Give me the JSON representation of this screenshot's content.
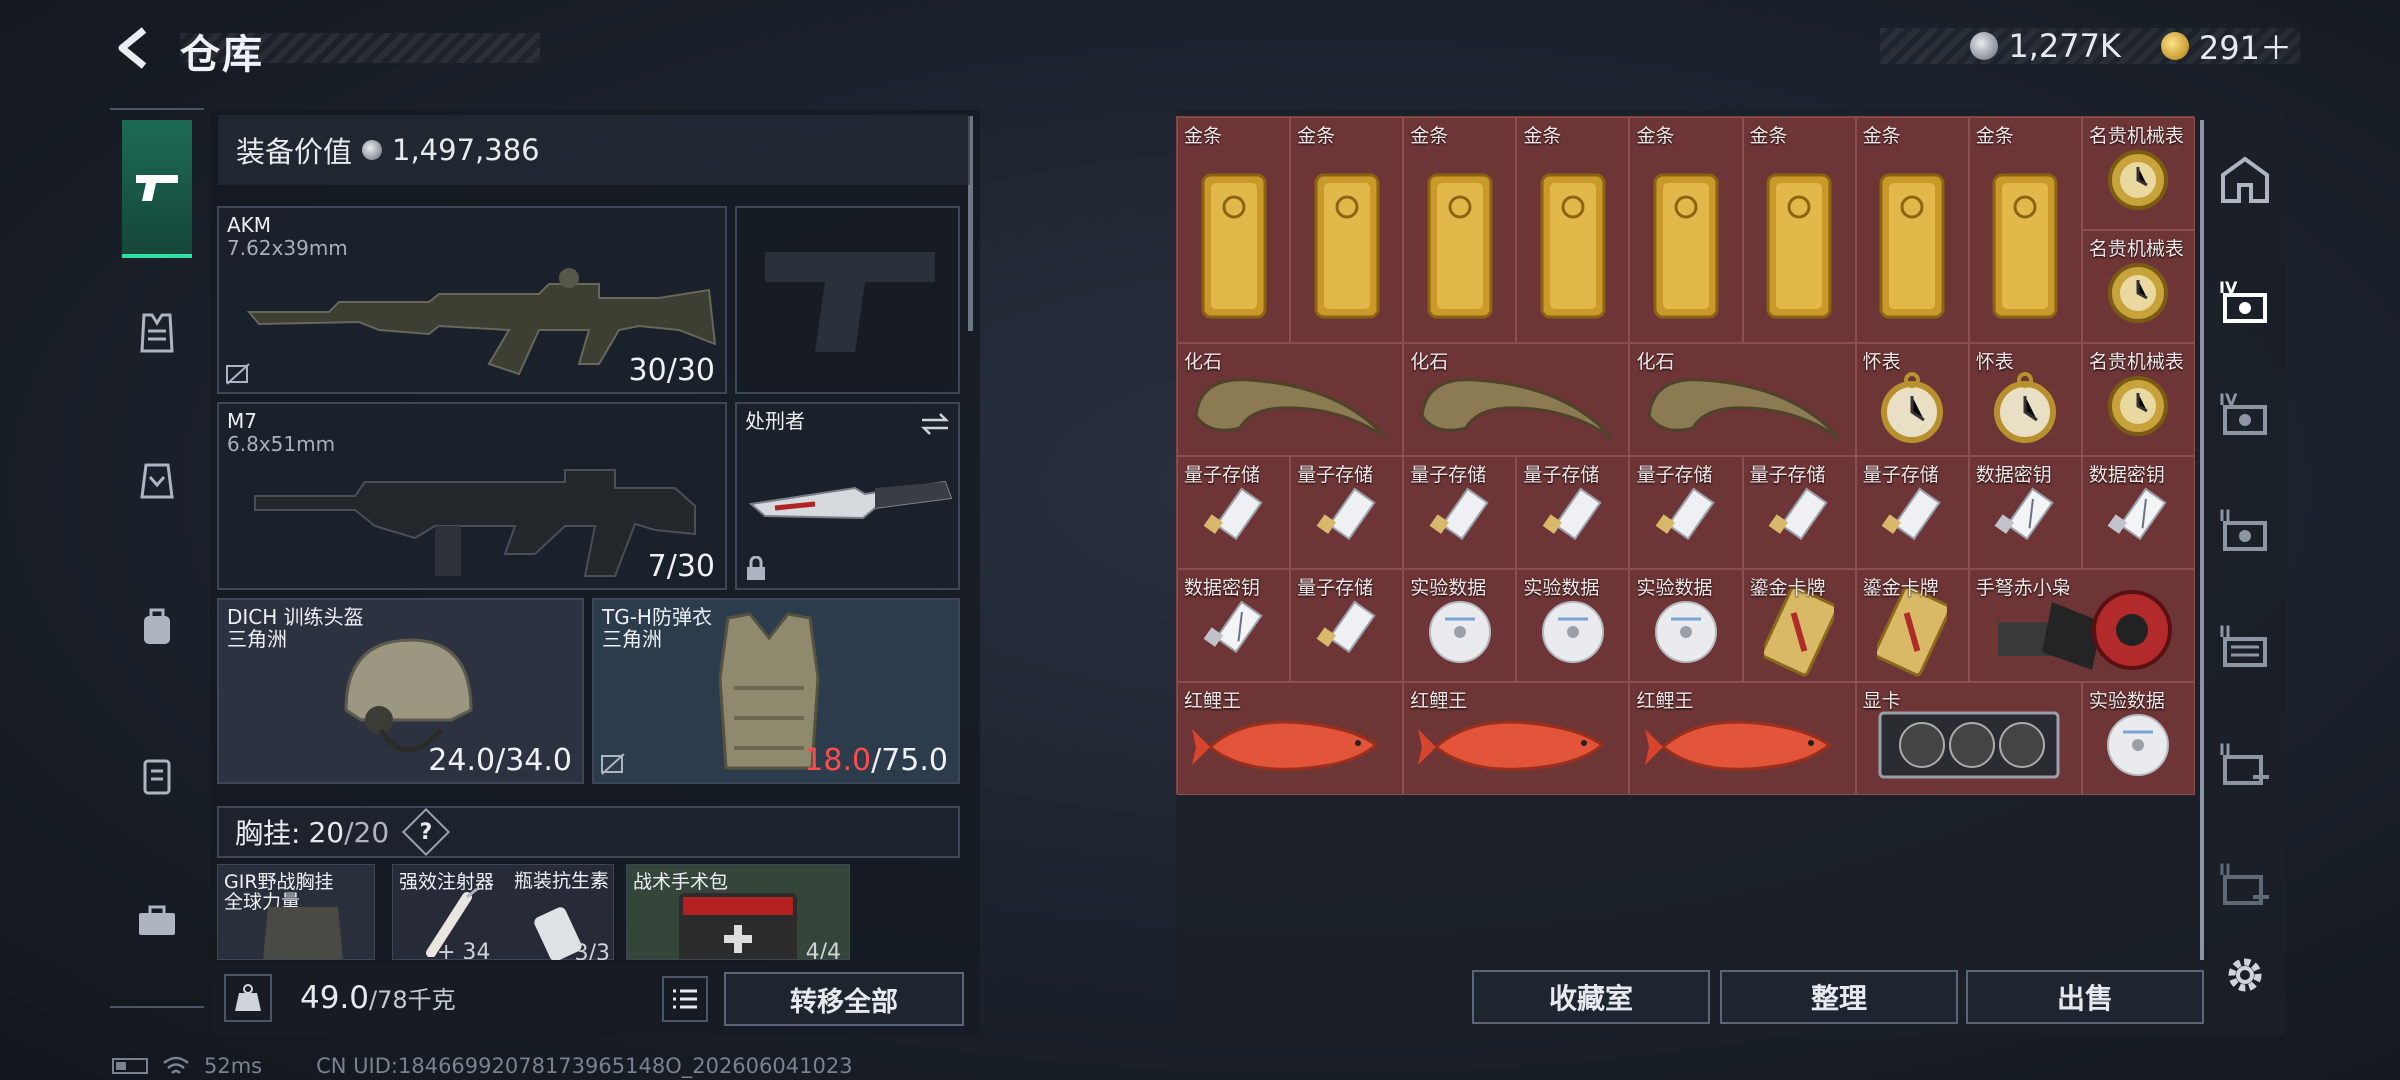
{
  "header": {
    "title": "仓库",
    "silver": "1,277K",
    "gold": "291＋"
  },
  "equipment": {
    "label": "装备价值",
    "value": "1,497,386"
  },
  "slots": {
    "akm": {
      "name": "AKM",
      "ammo": "7.62x39mm",
      "count": "30/30"
    },
    "m7": {
      "name": "M7",
      "ammo": "6.8x51mm",
      "count": "7/30"
    },
    "knife": {
      "name": "处刑者"
    },
    "helmet": {
      "name": "DICH 训练头盔",
      "brand": "三角洲",
      "count": "24.0/34.0"
    },
    "armor": {
      "name": "TG-H防弹衣",
      "brand": "三角洲",
      "dur": "18.0",
      "max": "/75.0"
    }
  },
  "chest": {
    "label": "胸挂:",
    "cur": "20",
    "max": "/20",
    "help": "?"
  },
  "rig": [
    {
      "name": "GIR野战胸挂",
      "sub": "全球力量"
    },
    {
      "name": "强效注射器",
      "count": "+ 34"
    },
    {
      "name": "瓶装抗生素",
      "count": "3/3"
    },
    {
      "name": "战术手术包",
      "count": "4/4"
    }
  ],
  "footer": {
    "weight": "49.0",
    "weight_max": "/78千克",
    "transfer": "转移全部"
  },
  "status": {
    "ping": "52ms",
    "uid": "CN UID:18466992078173965148O_202606041023"
  },
  "stash": {
    "names": {
      "gold": "金条",
      "watch": "名贵机械表",
      "fossil": "化石",
      "pocket": "怀表",
      "quantum": "量子存储",
      "key": "数据密钥",
      "disk": "实验数据",
      "card": "鎏金卡牌",
      "owl": "手弩赤小枭",
      "carp": "红鲤王",
      "gpu": "显卡"
    }
  },
  "buttons": {
    "vault": "收藏室",
    "sort": "整理",
    "sell": "出售"
  },
  "colors": {
    "accent": "#2fe0a5",
    "stash_bg": "#6e3537",
    "danger": "#ff4b4b"
  }
}
